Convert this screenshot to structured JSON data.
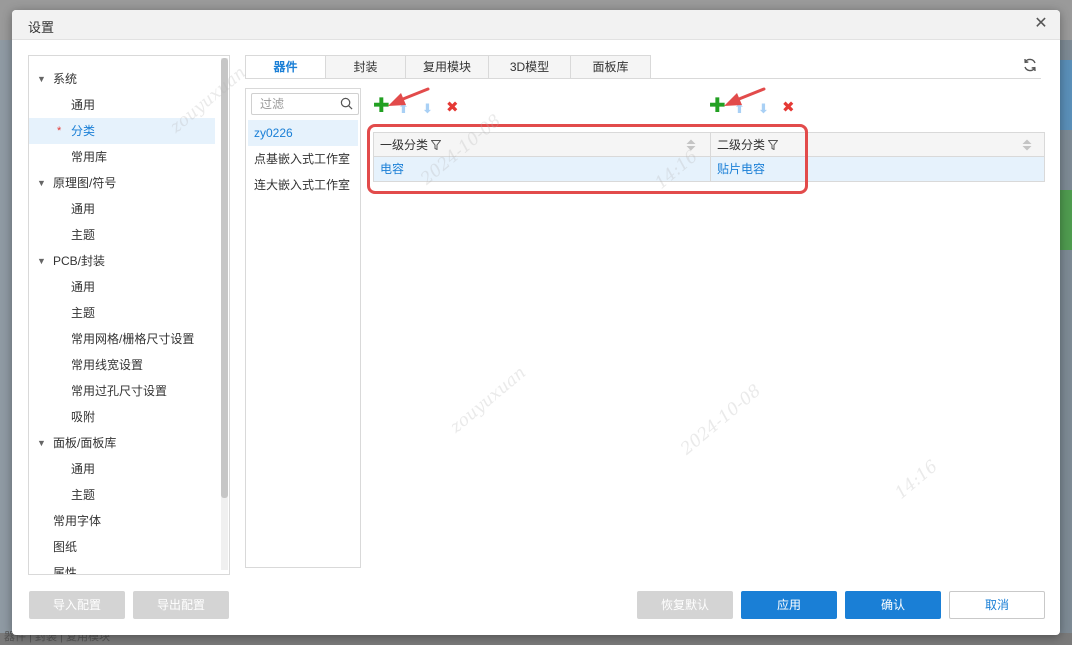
{
  "dialog": {
    "title": "设置",
    "close_symbol": "✕"
  },
  "tree": {
    "items": [
      {
        "label": "系统"
      },
      {
        "label": "通用"
      },
      {
        "label": "分类",
        "marker": "*"
      },
      {
        "label": "常用库"
      },
      {
        "label": "原理图/符号"
      },
      {
        "label": "通用"
      },
      {
        "label": "主题"
      },
      {
        "label": "PCB/封装"
      },
      {
        "label": "通用"
      },
      {
        "label": "主题"
      },
      {
        "label": "常用网格/栅格尺寸设置"
      },
      {
        "label": "常用线宽设置"
      },
      {
        "label": "常用过孔尺寸设置"
      },
      {
        "label": "吸附"
      },
      {
        "label": "面板/面板库"
      },
      {
        "label": "通用"
      },
      {
        "label": "主题"
      },
      {
        "label": "常用字体"
      },
      {
        "label": "图纸"
      },
      {
        "label": "属性"
      }
    ],
    "import_label": "导入配置",
    "export_label": "导出配置"
  },
  "tabs": [
    "器件",
    "封装",
    "复用模块",
    "3D模型",
    "面板库"
  ],
  "libs": {
    "filter_placeholder": "过滤",
    "items": [
      "zy0226",
      "点基嵌入式工作室",
      "连大嵌入式工作室"
    ]
  },
  "grid": {
    "columns": [
      "一级分类",
      "二级分类"
    ],
    "rows": [
      [
        "电容",
        "贴片电容"
      ]
    ]
  },
  "buttons": {
    "restore": "恢复默认",
    "apply": "应用",
    "ok": "确认",
    "cancel": "取消"
  },
  "background": {
    "bottom_text": "器件 | 封装 | 复用模块"
  },
  "watermark": {
    "texts": [
      "zouyuxuan",
      "2024-10-08",
      "14:16"
    ]
  },
  "colors": {
    "accent": "#1a7fd6",
    "highlight": "#e24b4b",
    "add": "#22a022",
    "delete": "#e53935"
  },
  "icons": {
    "add": "plus-icon",
    "up": "arrow-up-icon",
    "down": "arrow-down-icon",
    "delete": "delete-icon",
    "refresh": "refresh-icon",
    "search": "search-icon"
  }
}
